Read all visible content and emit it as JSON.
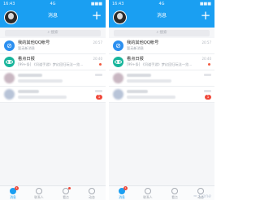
{
  "status": {
    "time": "16:43",
    "signal": "4G",
    "battery": "■■■"
  },
  "header": {
    "title": "消息",
    "plus": "+"
  },
  "search": {
    "placeholder": "搜索",
    "icon": "search-icon"
  },
  "chats": [
    {
      "name": "我的其他QQ帐号",
      "preview": "暂无新消息",
      "time": "20:57",
      "icon": "link-icon",
      "color": "#2b8ff0"
    },
    {
      "name": "看点日报",
      "preview": "[99+条] 《问道手游》梦幻回归玩法一览…",
      "time": "20:40",
      "icon": "eye-icon",
      "color": "#17b59b"
    }
  ],
  "blurred_right": {
    "badge": "1"
  },
  "tabs": [
    {
      "label": "消息",
      "active": true
    },
    {
      "label": "联系人",
      "active": false
    },
    {
      "label": "看点",
      "active": false
    },
    {
      "label": "动态",
      "active": false
    }
  ],
  "tab_badge": "1",
  "watermark": "≈ Cone",
  "colors": {
    "accent": "#1a9ff2",
    "badge": "#f0493b"
  }
}
